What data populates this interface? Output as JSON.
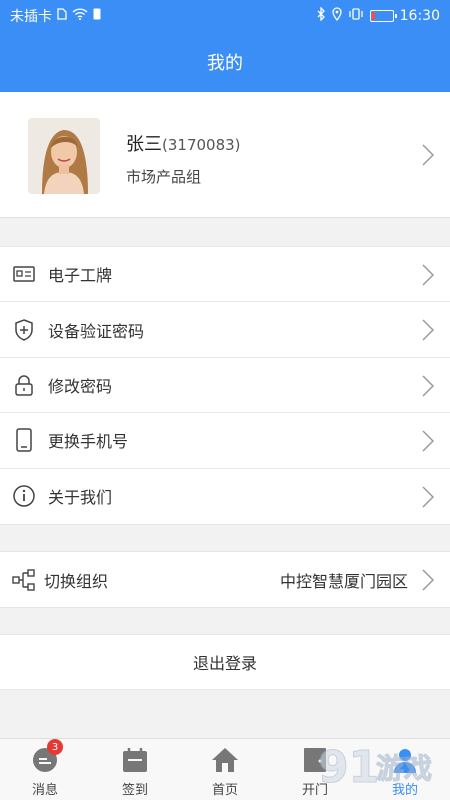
{
  "status": {
    "carrier": "未插卡",
    "time": "16:30"
  },
  "header": {
    "title": "我的"
  },
  "profile": {
    "name": "张三",
    "id": "(3170083)",
    "department": "市场产品组"
  },
  "menu": [
    {
      "label": "电子工牌",
      "icon": "badge-card-icon"
    },
    {
      "label": "设备验证密码",
      "icon": "shield-icon"
    },
    {
      "label": "修改密码",
      "icon": "lock-icon"
    },
    {
      "label": "更换手机号",
      "icon": "phone-icon"
    },
    {
      "label": "关于我们",
      "icon": "info-icon"
    }
  ],
  "org": {
    "label": "切换组织",
    "value": "中控智慧厦门园区"
  },
  "logout": {
    "label": "退出登录"
  },
  "tabs": [
    {
      "label": "消息",
      "badge": "3"
    },
    {
      "label": "签到"
    },
    {
      "label": "首页"
    },
    {
      "label": "开门"
    },
    {
      "label": "我的"
    }
  ],
  "colors": {
    "primary": "#3a8ef5",
    "badge": "#e53935"
  }
}
